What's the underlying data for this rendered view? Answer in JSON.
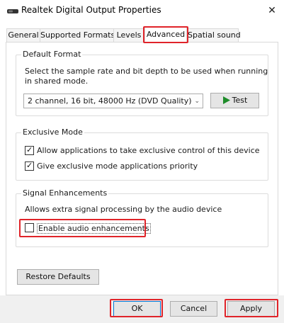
{
  "window": {
    "title": "Realtek Digital Output Properties"
  },
  "tabs": [
    {
      "label": "General"
    },
    {
      "label": "Supported Formats"
    },
    {
      "label": "Levels"
    },
    {
      "label": "Advanced",
      "active": true
    },
    {
      "label": "Spatial sound"
    }
  ],
  "default_format": {
    "legend": "Default Format",
    "description_line1": "Select the sample rate and bit depth to be used when running",
    "description_line2": "in shared mode.",
    "selected": "2 channel, 16 bit, 48000 Hz (DVD Quality)",
    "test_label": "Test"
  },
  "exclusive_mode": {
    "legend": "Exclusive Mode",
    "allow_label": "Allow applications to take exclusive control of this device",
    "allow_checked": true,
    "priority_label": "Give exclusive mode applications priority",
    "priority_checked": true
  },
  "signal_enhancements": {
    "legend": "Signal Enhancements",
    "description": "Allows extra signal processing by the audio device",
    "enable_label": "Enable audio enhancements",
    "enable_checked": false
  },
  "buttons": {
    "restore_label": "Restore Defaults",
    "ok_label": "OK",
    "cancel_label": "Cancel",
    "apply_label": "Apply"
  },
  "colors": {
    "highlight": "#e0242a",
    "play_icon": "#1e8c2a"
  }
}
